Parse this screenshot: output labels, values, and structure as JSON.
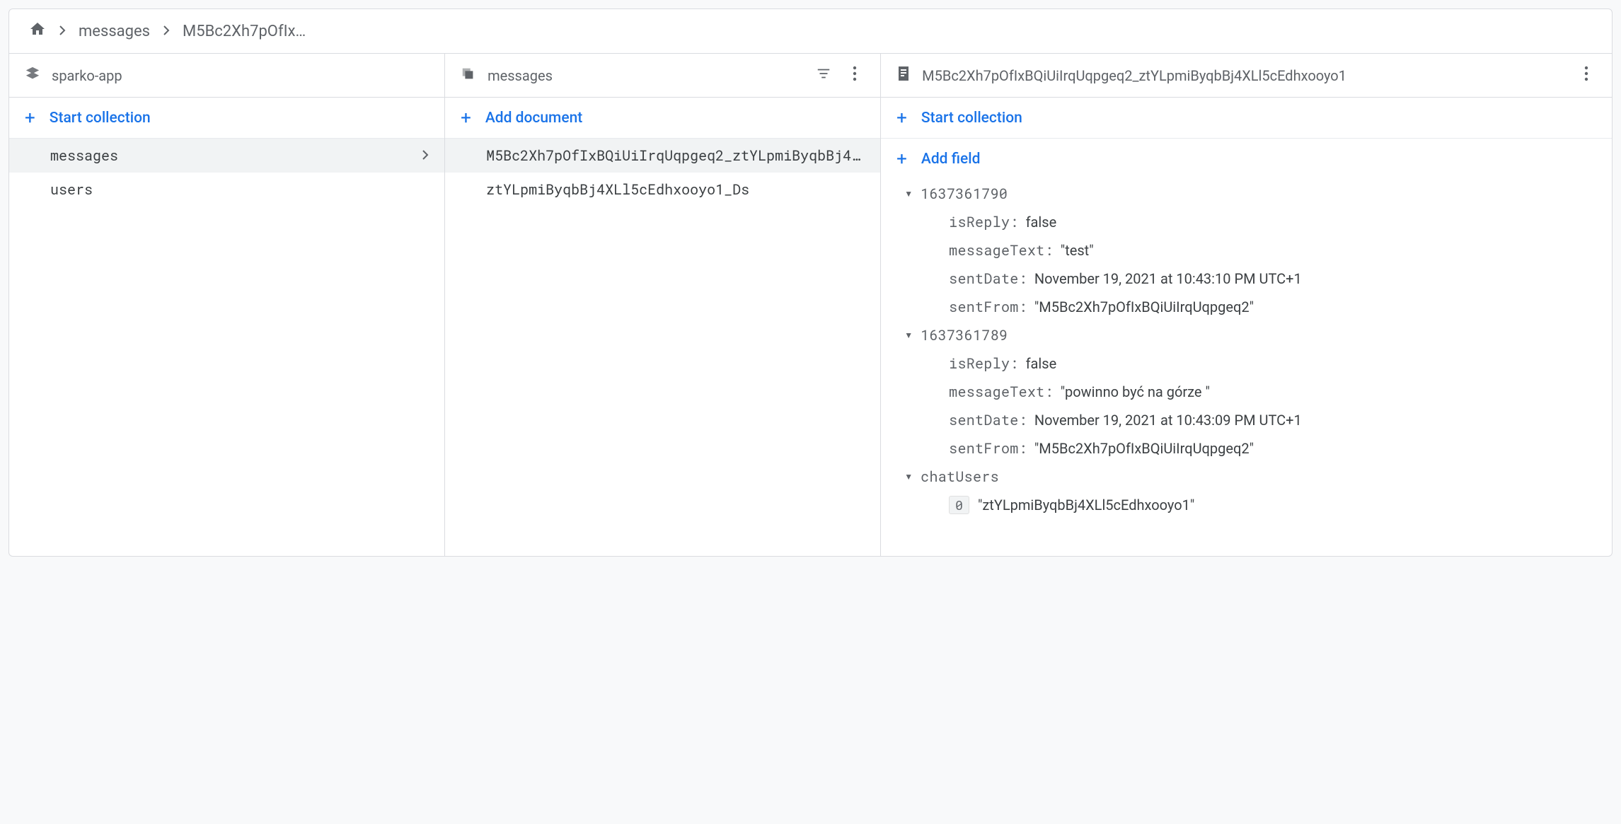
{
  "breadcrumb": {
    "items": [
      "messages",
      "M5Bc2Xh7pOfIx…"
    ]
  },
  "col_root": {
    "title": "sparko-app",
    "start_collection": "Start collection",
    "collections": [
      {
        "name": "messages",
        "selected": true
      },
      {
        "name": "users",
        "selected": false
      }
    ]
  },
  "col_docs": {
    "title": "messages",
    "add_document": "Add document",
    "documents": [
      {
        "id": "M5Bc2Xh7pOfIxBQiUiIrqUqpgeq2_ztYLpmiByqbBj4XLl5cEdhxooyo1",
        "selected": true
      },
      {
        "id": "ztYLpmiByqbBj4XLl5cEdhxooyo1_Ds",
        "selected": false
      }
    ]
  },
  "col_doc": {
    "title": "M5Bc2Xh7pOfIxBQiUiIrqUqpgeq2_ztYLpmiByqbBj4XLl5cEdhxooyo1",
    "start_collection": "Start collection",
    "add_field": "Add field",
    "field_labels": {
      "isReply": "isReply:",
      "messageText": "messageText:",
      "sentDate": "sentDate:",
      "sentFrom": "sentFrom:"
    },
    "maps": [
      {
        "key": "1637361790",
        "isReply": "false",
        "messageText": "\"test\"",
        "sentDate": "November 19, 2021 at 10:43:10 PM UTC+1",
        "sentFrom": "\"M5Bc2Xh7pOfIxBQiUiIrqUqpgeq2\""
      },
      {
        "key": "1637361789",
        "isReply": "false",
        "messageText": "\"powinno być na górze \"",
        "sentDate": "November 19, 2021 at 10:43:09 PM UTC+1",
        "sentFrom": "\"M5Bc2Xh7pOfIxBQiUiIrqUqpgeq2\""
      }
    ],
    "chatUsers": {
      "key": "chatUsers",
      "items": [
        {
          "index": "0",
          "value": "\"ztYLpmiByqbBj4XLl5cEdhxooyo1\""
        }
      ]
    }
  }
}
